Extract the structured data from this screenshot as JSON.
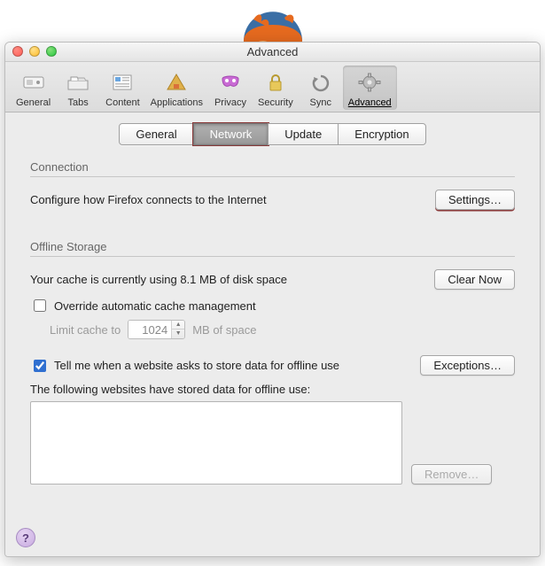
{
  "window_title": "Advanced",
  "toolbar": [
    {
      "label": "General",
      "icon": "switch-icon"
    },
    {
      "label": "Tabs",
      "icon": "tabs-icon"
    },
    {
      "label": "Content",
      "icon": "content-icon"
    },
    {
      "label": "Applications",
      "icon": "applications-icon"
    },
    {
      "label": "Privacy",
      "icon": "privacy-icon"
    },
    {
      "label": "Security",
      "icon": "security-icon"
    },
    {
      "label": "Sync",
      "icon": "sync-icon"
    },
    {
      "label": "Advanced",
      "icon": "gear-icon",
      "active": true
    }
  ],
  "subtabs": [
    {
      "label": "General"
    },
    {
      "label": "Network",
      "active": true
    },
    {
      "label": "Update"
    },
    {
      "label": "Encryption"
    }
  ],
  "connection": {
    "header": "Connection",
    "desc": "Configure how Firefox connects to the Internet",
    "settings_btn": "Settings…"
  },
  "offline": {
    "header": "Offline Storage",
    "cache_line": "Your cache is currently using 8.1 MB of disk space",
    "clear_btn": "Clear Now",
    "override_label": "Override automatic cache management",
    "override_checked": false,
    "limit_prefix": "Limit cache to",
    "limit_value": "1024",
    "limit_suffix": "MB of space",
    "tell_me_label": "Tell me when a website asks to store data for offline use",
    "tell_me_checked": true,
    "exceptions_btn": "Exceptions…",
    "stored_label": "The following websites have stored data for offline use:",
    "remove_btn": "Remove…"
  },
  "help_glyph": "?"
}
